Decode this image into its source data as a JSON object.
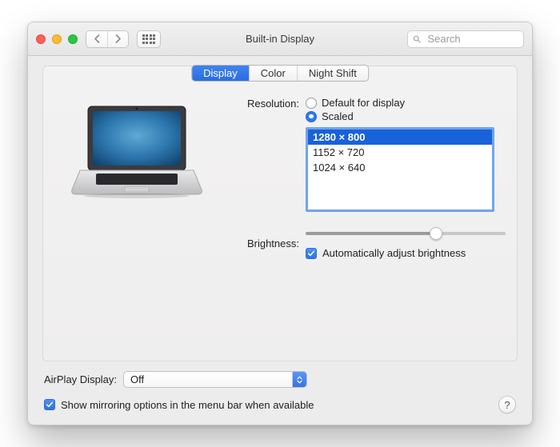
{
  "window": {
    "title": "Built-in Display"
  },
  "search": {
    "placeholder": "Search",
    "value": ""
  },
  "tabs": {
    "display": "Display",
    "color": "Color",
    "night_shift": "Night Shift",
    "active": "display"
  },
  "resolution": {
    "label": "Resolution:",
    "opt_default": "Default for display",
    "opt_scaled": "Scaled",
    "selected": "scaled",
    "options": [
      "1280 × 800",
      "1152 × 720",
      "1024 × 640"
    ],
    "selected_index": 0
  },
  "brightness": {
    "label": "Brightness:",
    "percent": 65,
    "auto_label": "Automatically adjust brightness",
    "auto_checked": true
  },
  "airplay": {
    "label": "AirPlay Display:",
    "value": "Off"
  },
  "mirroring": {
    "label": "Show mirroring options in the menu bar when available",
    "checked": true
  }
}
